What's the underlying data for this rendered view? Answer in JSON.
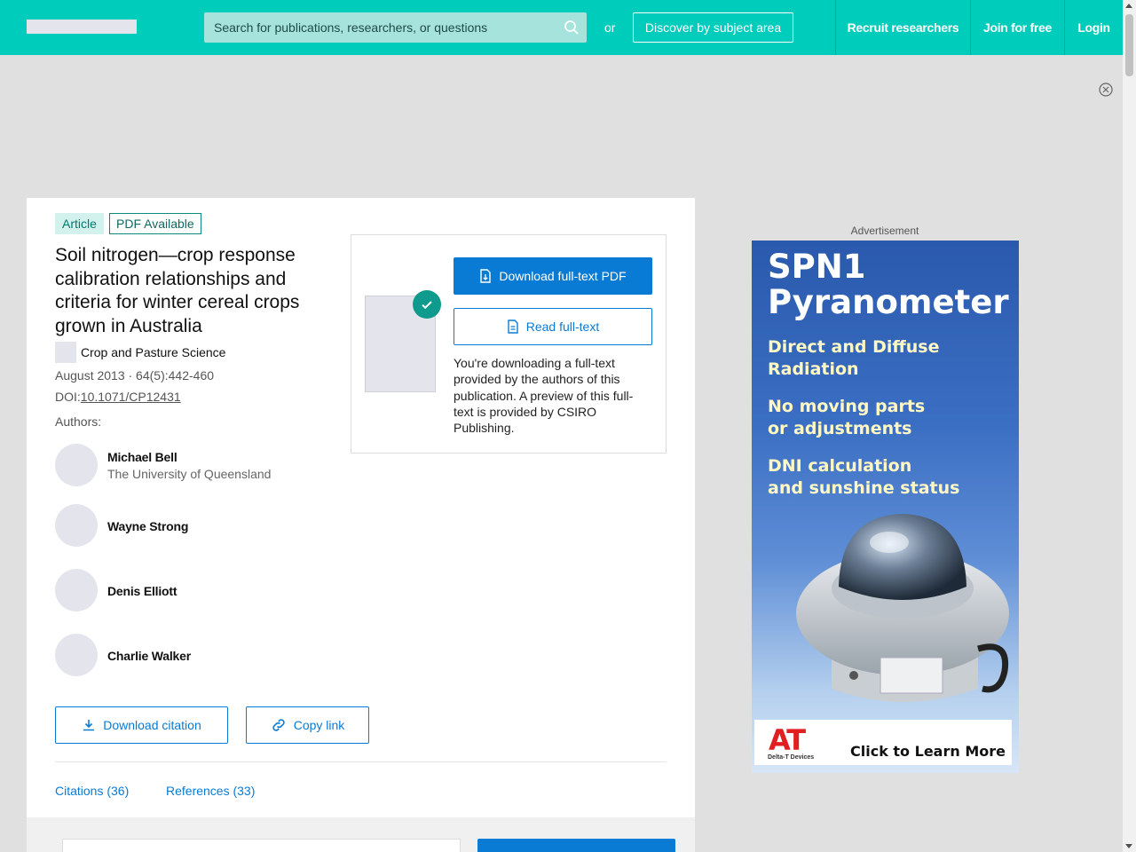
{
  "header": {
    "search_placeholder": "Search for publications, researchers, or questions",
    "or_text": "or",
    "discover_label": "Discover by subject area",
    "nav": [
      "Recruit researchers",
      "Join for free",
      "Login"
    ]
  },
  "publication": {
    "type_badge": "Article",
    "pdf_badge": "PDF Available",
    "title": "Soil nitrogen—crop response calibration relationships and criteria for winter cereal crops grown in Australia",
    "journal": "Crop and Pasture Science",
    "meta": "August 2013 · 64(5):442-460",
    "doi_label": "DOI:",
    "doi": "10.1071/CP12431",
    "authors_label": "Authors:",
    "authors": [
      {
        "name": "Michael Bell",
        "affiliation": "The University of Queensland"
      },
      {
        "name": "Wayne Strong",
        "affiliation": ""
      },
      {
        "name": "Denis Elliott",
        "affiliation": ""
      },
      {
        "name": "Charlie Walker",
        "affiliation": ""
      }
    ]
  },
  "actions": {
    "download_citation": "Download citation",
    "copy_link": "Copy link"
  },
  "tabs": {
    "citations": "Citations (36)",
    "references": "References (33)"
  },
  "download_box": {
    "primary": "Download full-text PDF",
    "secondary": "Read full-text",
    "note": "You're downloading a full-text provided by the authors of this publication. A preview of this full-text is provided by CSIRO Publishing."
  },
  "ad": {
    "label": "Advertisement",
    "headline_1": "SPN1",
    "headline_2": "Pyranometer",
    "line_1a": "Direct and Diffuse",
    "line_1b": "Radiation",
    "line_2a": "No moving parts",
    "line_2b": "or adjustments",
    "line_3a": "DNI calculation",
    "line_3b": "and sunshine status",
    "brand": "AT",
    "brand_sub": "Delta-T Devices",
    "cta": "Click to Learn More"
  },
  "colors": {
    "header_bg": "#00ccbb",
    "primary_blue": "#0a7bd4",
    "teal_check": "#0e9a8c"
  }
}
